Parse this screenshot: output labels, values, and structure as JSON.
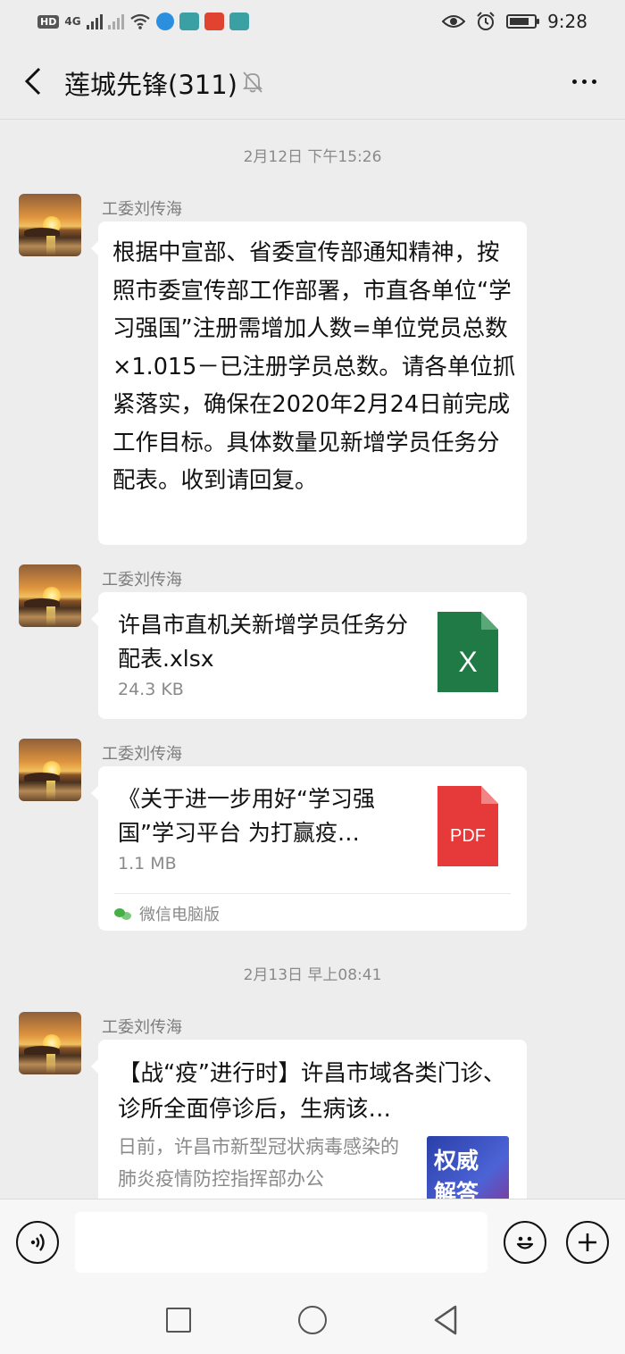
{
  "status_bar": {
    "hd": "HD",
    "network": "4G",
    "time": "9:28",
    "battery_level": 0.8
  },
  "header": {
    "title": "莲城先锋(311)",
    "muted": true
  },
  "chat": {
    "timestamps": [
      "2月12日 下午15:26",
      "2月13日 早上08:41"
    ],
    "messages": [
      {
        "sender": "工委刘传海",
        "type": "text",
        "text": "根据中宣部、省委宣传部通知精神，按照市委宣传部工作部署，市直各单位“学习强国”注册需增加人数=单位党员总数×1.015－已注册学员总数。请各单位抓紧落实，确保在2020年2月24日前完成工作目标。具体数量见新增学员任务分配表。收到请回复。"
      },
      {
        "sender": "工委刘传海",
        "type": "file",
        "file_name": "许昌市直机关新增学员任务分配表.xlsx",
        "file_size": "24.3 KB",
        "file_icon": "excel-icon",
        "icon_label": "X",
        "icon_color": "#1f7a45"
      },
      {
        "sender": "工委刘传海",
        "type": "file",
        "file_name": "《关于进一步用好“学习强国”学习平台 为打赢疫…",
        "file_size": "1.1 MB",
        "file_icon": "pdf-icon",
        "icon_label": "PDF",
        "icon_color": "#e5393a",
        "source": "微信电脑版"
      },
      {
        "sender": "工委刘传海",
        "type": "link",
        "title": "【战“疫”进行时】许昌市域各类门诊、诊所全面停诊后，生病该…",
        "description": "日前，许昌市新型冠状病毒感染的肺炎疫情防控指挥部办公",
        "thumb_line1": "权威",
        "thumb_line2": "解答"
      }
    ]
  },
  "input": {
    "placeholder": ""
  },
  "colors": {
    "background": "#ededed",
    "bubble": "#ffffff",
    "excel": "#1f7a45",
    "pdf": "#e5393a",
    "wechat_green": "#45b045"
  }
}
